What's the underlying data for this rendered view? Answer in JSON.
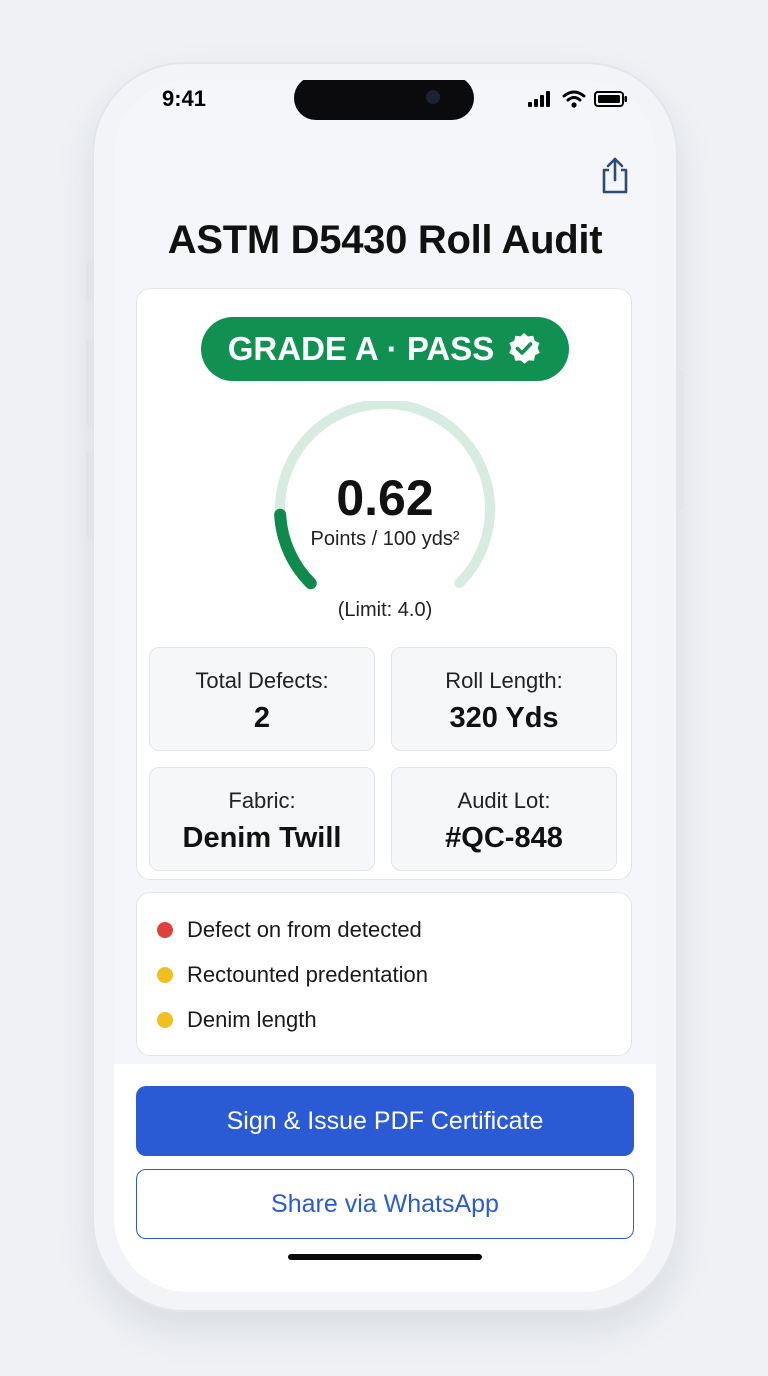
{
  "status_bar": {
    "time": "9:41"
  },
  "header": {
    "title": "ASTM D5430 Roll Audit"
  },
  "grade": {
    "label": "GRADE A · PASS"
  },
  "gauge": {
    "value": "0.62",
    "unit": "Points / 100 yds²",
    "limit_text": "(Limit: 4.0)",
    "score": 0.62,
    "limit": 4.0,
    "track_color": "#d6ece0",
    "fill_color": "#0f8a4c"
  },
  "stats": [
    {
      "label": "Total Defects:",
      "value": "2"
    },
    {
      "label": "Roll Length:",
      "value": "320 Yds"
    },
    {
      "label": "Fabric:",
      "value": "Denim Twill"
    },
    {
      "label": "Audit Lot:",
      "value": "#QC-848"
    }
  ],
  "notes": [
    {
      "text": "Defect on from detected",
      "color": "#e0403a"
    },
    {
      "text": "Rectounted predentation",
      "color": "#f0c020"
    },
    {
      "text": "Denim length",
      "color": "#f0c020"
    }
  ],
  "actions": {
    "primary_label": "Sign & Issue PDF Certificate",
    "secondary_label": "Share via WhatsApp"
  },
  "colors": {
    "accent": "#2b5bd4",
    "pass": "#109152"
  },
  "icons": [
    "signal-icon",
    "wifi-icon",
    "battery-icon",
    "share-icon",
    "verified-check-icon"
  ]
}
